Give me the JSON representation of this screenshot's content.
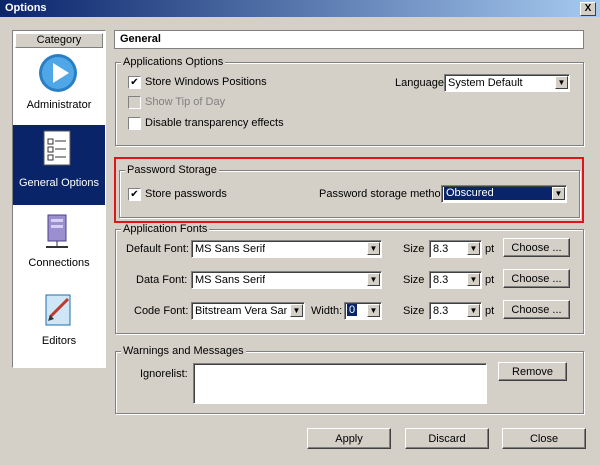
{
  "window": {
    "title": "Options",
    "close": "X"
  },
  "category": {
    "header": "Category",
    "items": [
      {
        "label": "Administrator"
      },
      {
        "label": "General Options"
      },
      {
        "label": "Connections"
      },
      {
        "label": "Editors"
      }
    ]
  },
  "main": {
    "title": "General"
  },
  "app_options": {
    "title": "Applications Options",
    "store_windows": "Store Windows Positions",
    "show_tip": "Show Tip of Day",
    "disable_transparency": "Disable transparency effects",
    "language_label": "Language:",
    "language_value": "System Default",
    "checked_mark": "✔"
  },
  "password": {
    "title": "Password Storage",
    "store": "Store passwords",
    "method_label": "Password storage method:",
    "method_value": "Obscured"
  },
  "fonts": {
    "title": "Application Fonts",
    "rows": [
      {
        "label": "Default Font:",
        "font": "MS Sans Serif",
        "size_label": "Size",
        "size": "8.3",
        "pt": "pt",
        "choose": "Choose ..."
      },
      {
        "label": "Data Font:",
        "font": "MS Sans Serif",
        "size_label": "Size",
        "size": "8.3",
        "pt": "pt",
        "choose": "Choose ..."
      },
      {
        "label": "Code Font:",
        "font": "Bitstream Vera Sans M",
        "size_label": "Size",
        "size": "8.3",
        "pt": "pt",
        "choose": "Choose ..."
      }
    ],
    "width_label": "Width:",
    "width_value": "0"
  },
  "warnings": {
    "title": "Warnings and Messages",
    "ignore_label": "Ignorelist:",
    "remove": "Remove"
  },
  "footer": {
    "apply": "Apply",
    "discard": "Discard",
    "close": "Close"
  }
}
